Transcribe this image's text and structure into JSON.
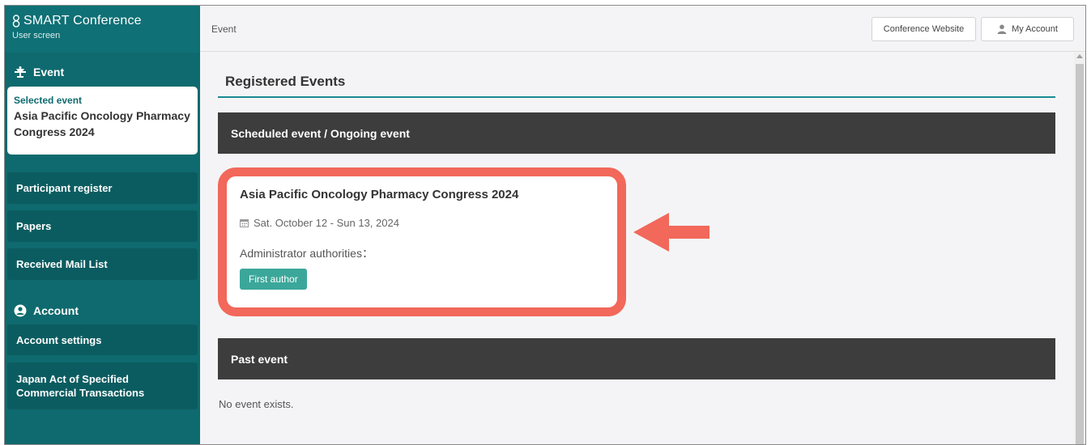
{
  "brand": {
    "title": "SMART Conference",
    "subtitle": "User screen"
  },
  "sidebar": {
    "event_section": "Event",
    "selected_label": "Selected event",
    "selected_name": "Asia Pacific Oncology Pharmacy Congress 2024",
    "items": [
      {
        "label": "Participant register"
      },
      {
        "label": "Papers"
      },
      {
        "label": "Received Mail List"
      }
    ],
    "account_section": "Account",
    "account_items": [
      {
        "label": "Account settings"
      },
      {
        "label": "Japan Act of Specified Commercial Transactions"
      }
    ]
  },
  "topbar": {
    "breadcrumb": "Event",
    "conference_website": "Conference Website",
    "my_account": "My Account"
  },
  "main": {
    "page_title": "Registered Events",
    "scheduled_heading": "Scheduled event / Ongoing event",
    "event": {
      "title": "Asia Pacific Oncology Pharmacy Congress 2024",
      "date": "Sat. October 12 - Sun 13, 2024",
      "authority_label": "Administrator authorities：",
      "authority_badge": "First author"
    },
    "past_heading": "Past event",
    "no_event": "No event exists."
  },
  "colors": {
    "sidebar": "#0e6a6e",
    "accent": "#1a8a91",
    "highlight": "#f2685a",
    "badge": "#3ba79a",
    "band": "#3d3d3d"
  },
  "icons": [
    "eight-logo-icon",
    "podium-icon",
    "user-circle-icon",
    "calendar-icon",
    "person-icon",
    "arrow-left-icon"
  ]
}
